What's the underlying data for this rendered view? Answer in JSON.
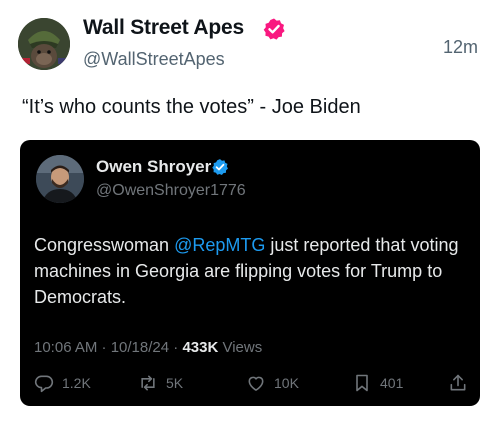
{
  "author": {
    "display_name": "Wall Street Apes",
    "handle": "@WallStreetApes",
    "verified_color": "#f91880",
    "avatar_icon": "gorilla-helmet-avatar"
  },
  "time_ago": "12m",
  "post_text": "“It’s who counts the votes” - Joe Biden",
  "quoted": {
    "display_name": "Owen Shroyer",
    "handle": "@OwenShroyer1776",
    "verified_color": "#1d9bf0",
    "body_prefix": "Congresswoman ",
    "mention": "@RepMTG",
    "body_suffix": " just reported that voting machines in Georgia are flipping votes for Trump to Democrats.",
    "timestamp": "10:06 AM · 10/18/24 · ",
    "views_count": "433K",
    "views_label": " Views",
    "replies": "1.2K",
    "reposts": "5K",
    "likes": "10K",
    "bookmarks": "401"
  }
}
